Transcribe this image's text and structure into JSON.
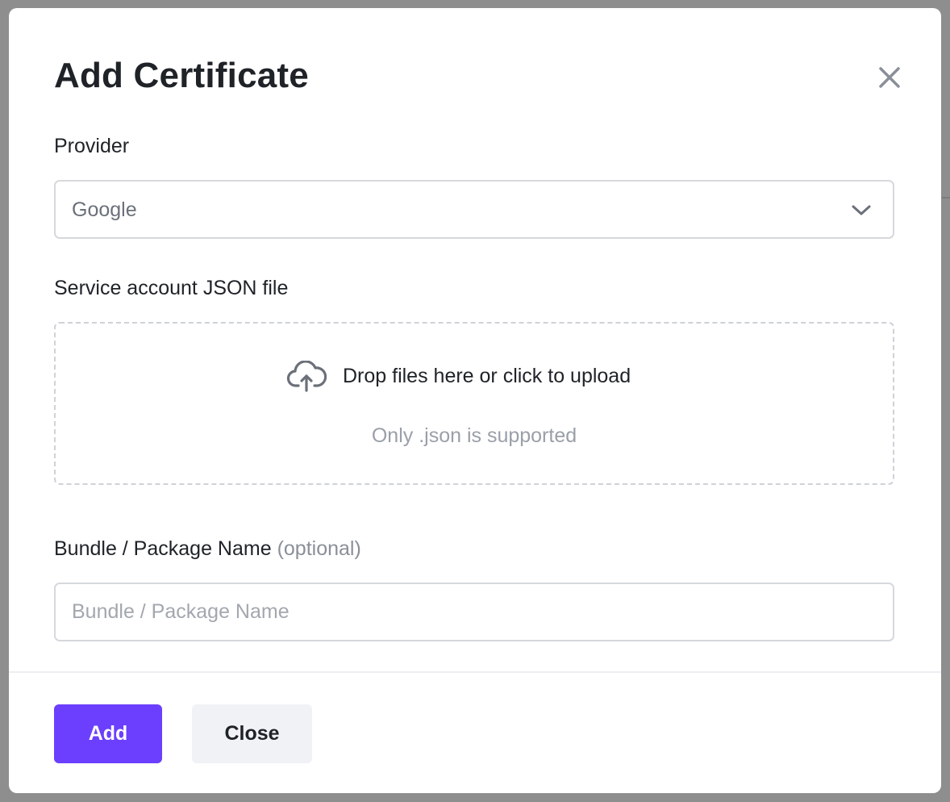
{
  "modal": {
    "title": "Add Certificate"
  },
  "provider": {
    "label": "Provider",
    "selected": "Google"
  },
  "upload": {
    "label": "Service account JSON file",
    "drop_text": "Drop files here or click to upload",
    "hint": "Only .json is supported"
  },
  "bundle": {
    "label": "Bundle / Package Name",
    "optional": "(optional)",
    "placeholder": "Bundle / Package Name",
    "value": ""
  },
  "footer": {
    "add_label": "Add",
    "close_label": "Close"
  },
  "icons": {
    "close": "close-icon",
    "chevron": "chevron-down-icon",
    "upload": "cloud-upload-icon"
  },
  "colors": {
    "primary": "#6b3ffd",
    "secondary_bg": "#f1f2f5",
    "text": "#1f2328",
    "muted": "#8a8f99"
  }
}
